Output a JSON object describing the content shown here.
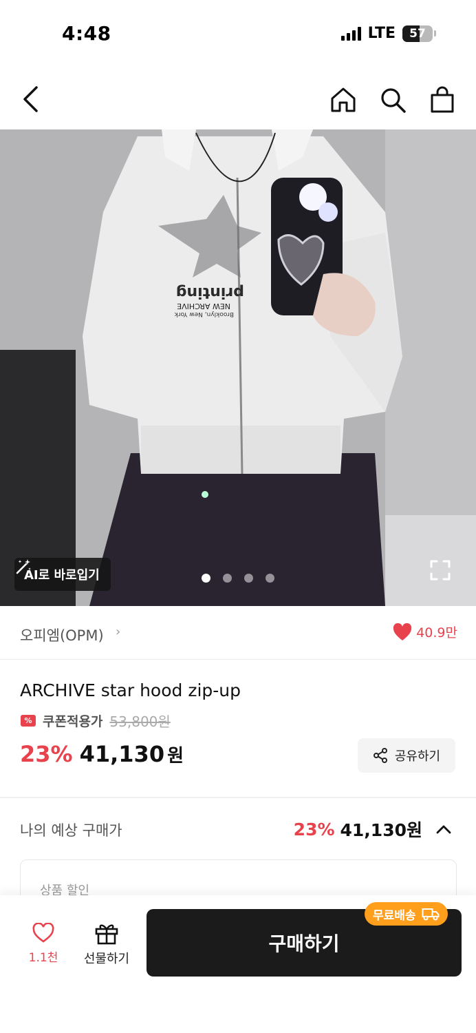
{
  "status": {
    "time": "4:48",
    "network": "LTE",
    "battery": "57",
    "battery_level": 0.57
  },
  "nav": {
    "icons": [
      "back-icon",
      "home-icon",
      "search-icon",
      "bag-icon"
    ]
  },
  "hero": {
    "ai_badge": "AI로 바로입기",
    "slide_count": 4,
    "active_slide": 1,
    "print_lines": [
      "NEW ARCHIVE",
      "Brooklyn, New York"
    ]
  },
  "brand": {
    "name": "오피엠(OPM)",
    "chevron": "›",
    "likes": "40.9만"
  },
  "product": {
    "title": "ARCHIVE star hood zip-up",
    "coupon_icon": "%",
    "coupon_label": "쿠폰적용가",
    "original_price": "53,800원",
    "discount": "23%",
    "price": "41,130",
    "price_unit": "원",
    "share_label": "공유하기"
  },
  "expected": {
    "label": "나의 예상 구매가",
    "discount": "23%",
    "price": "41,130원",
    "detail_label": "상품 할인"
  },
  "bottom": {
    "wish_count": "1.1천",
    "gift_label": "선물하기",
    "buy_label": "구매하기",
    "free_shipping": "무료배송"
  },
  "colors": {
    "accent_red": "#e8434d",
    "buy_button": "#1b1b1b",
    "free_shipping": "#ff9f1c"
  }
}
